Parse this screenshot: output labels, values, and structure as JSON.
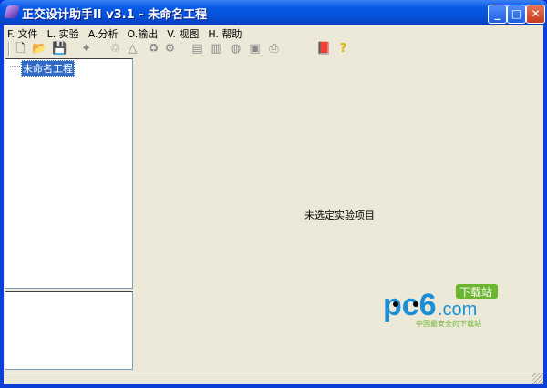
{
  "window": {
    "title": "正交设计助手II v3.1 - 未命名工程",
    "minimize": "_",
    "maximize": "□",
    "close": "✕"
  },
  "menu": [
    "F. 文件",
    "L. 实验",
    "A.分析",
    "O.输出",
    "V. 视图",
    "H. 帮助"
  ],
  "toolbar": [
    {
      "name": "new-icon",
      "glyph": "🗋"
    },
    {
      "name": "open-icon",
      "glyph": "📂"
    },
    {
      "name": "save-icon",
      "glyph": "💾"
    },
    {
      "name": "wizard-icon",
      "glyph": "✦"
    },
    {
      "name": "recycle-icon",
      "glyph": "♲"
    },
    {
      "name": "triangle-icon",
      "glyph": "△"
    },
    {
      "name": "refresh-icon",
      "glyph": "♻"
    },
    {
      "name": "tool-icon",
      "glyph": "⚙"
    },
    {
      "name": "doc-icon",
      "glyph": "▤"
    },
    {
      "name": "page-icon",
      "glyph": "▥"
    },
    {
      "name": "globe-icon",
      "glyph": "◍"
    },
    {
      "name": "image-icon",
      "glyph": "▣"
    },
    {
      "name": "print-icon",
      "glyph": "⎙"
    },
    {
      "name": "book-icon",
      "glyph": "📕"
    },
    {
      "name": "help-icon",
      "glyph": "?"
    }
  ],
  "tree": {
    "root": "未命名工程"
  },
  "main": {
    "message": "未选定实验项目"
  },
  "watermark": {
    "brand": "pc6",
    "domain": ".com",
    "badge": "下载站",
    "slogan": "中国最安全的下载站"
  }
}
